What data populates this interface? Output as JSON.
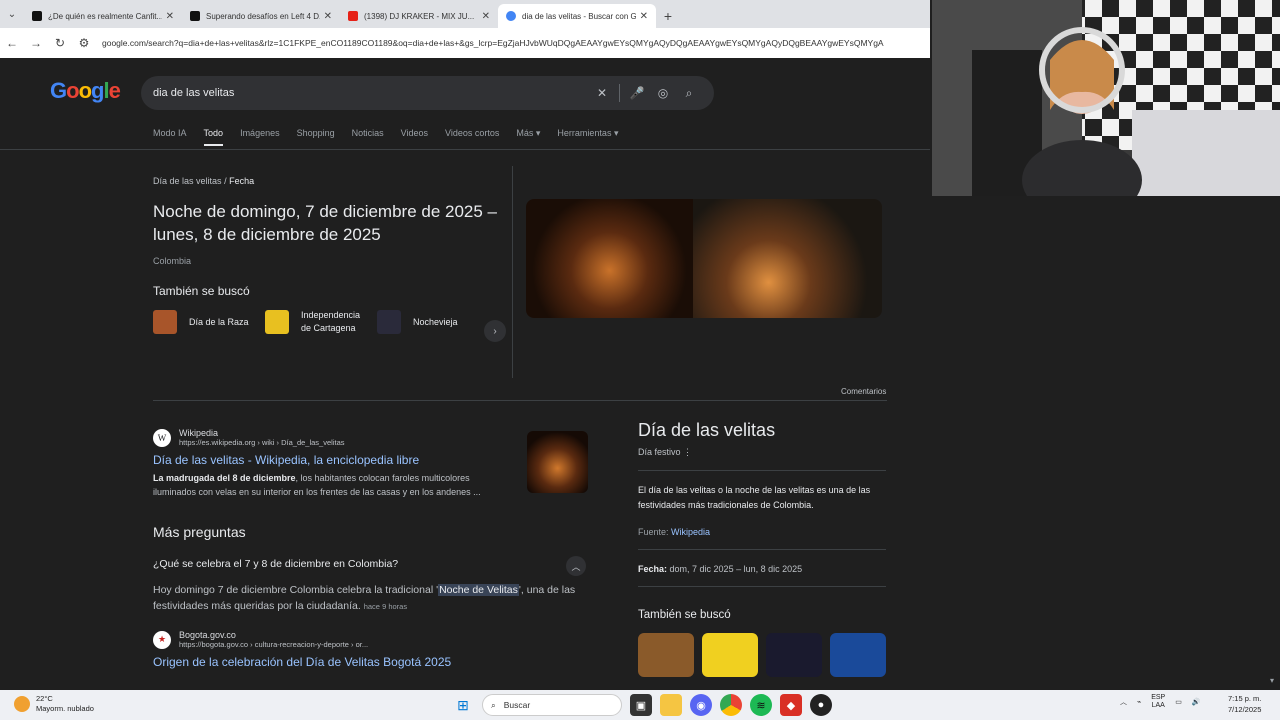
{
  "browser": {
    "tabs": [
      {
        "title": "¿De quién es realmente Canfit...",
        "favicon_color": "#111111",
        "active": false
      },
      {
        "title": "Superando desafíos en Left 4 D...",
        "favicon_color": "#111111",
        "active": false
      },
      {
        "title": "(1398) DJ KRAKER - MIX JU...",
        "favicon_color": "#e62117",
        "active": false
      },
      {
        "title": "dia de las velitas - Buscar con G...",
        "favicon_color": "#4285f4",
        "active": true
      }
    ],
    "new_tab_label": "+",
    "url": "google.com/search?q=dia+de+las+velitas&rlz=1C1FKPE_enCO1189CO1189&oq=dia+de+las+&gs_lcrp=EgZjaHJvbWUqDQgAEAAYgwEYsQMYgAQyDQgAEAAYgwEYsQMYgAQyDQgBEAAYgwEYsQMYgA"
  },
  "google": {
    "logo": "Google",
    "query": "dia de las velitas",
    "tabs": [
      "Modo IA",
      "Todo",
      "Imágenes",
      "Shopping",
      "Noticias",
      "Videos",
      "Videos cortos",
      "Más ▾",
      "Herramientas ▾"
    ],
    "active_tab": "Todo"
  },
  "featured": {
    "breadcrumb_root": "Día de las velitas",
    "breadcrumb_sep": "/",
    "breadcrumb_leaf": "Fecha",
    "date_text": "Noche de domingo, 7 de diciembre de 2025 – lunes, 8 de diciembre de 2025",
    "country": "Colombia",
    "also_heading": "También se buscó",
    "also_items": [
      {
        "label": "Día de la Raza",
        "color": "#a8552a"
      },
      {
        "label": "Independencia de Cartagena",
        "color": "#e8c020"
      },
      {
        "label": "Nochevieja",
        "color": "#2a2a3a"
      }
    ]
  },
  "feedback_label": "Comentarios",
  "result_wiki": {
    "site": "Wikipedia",
    "favicon_letter": "W",
    "cite": "https://es.wikipedia.org › wiki › Día_de_las_velitas",
    "title": "Día de las velitas - Wikipedia, la enciclopedia libre",
    "snippet_bold": "La madrugada del 8 de diciembre",
    "snippet_rest": ", los habitantes colocan faroles multicolores iluminados con velas en su interior en los frentes de las casas y en los andenes ..."
  },
  "paa": {
    "heading": "Más preguntas",
    "question": "¿Qué se celebra el 7 y 8 de diciembre en Colombia?",
    "answer_pre": "Hoy domingo 7 de diciembre Colombia celebra la tradicional '",
    "answer_mark": "Noche de Velitas",
    "answer_post": "', una de las festividades más queridas por la ciudadanía.",
    "answer_time": "hace 9 horas"
  },
  "result_bogota": {
    "site": "Bogota.gov.co",
    "favicon_letter": "★",
    "cite": "https://bogota.gov.co › cultura-recreacion-y-deporte › or...",
    "title": "Origen de la celebración del Día de Velitas Bogotá 2025"
  },
  "knowledge_panel": {
    "title": "Día de las velitas",
    "subtitle": "Día festivo",
    "description": "El día de las velitas o la noche de las velitas es una de las festividades más tradicionales de Colombia.",
    "source_label": "Fuente:",
    "source_link": "Wikipedia",
    "date_label": "Fecha:",
    "date_value": "dom, 7 dic 2025 – lun, 8 dic 2025",
    "also_heading": "También se buscó",
    "also_thumb_colors": [
      "#8a5a2a",
      "#f0d020",
      "#1a1a2e",
      "#1a4a9a"
    ]
  },
  "taskbar": {
    "temperature": "22°C",
    "weather": "Mayorm. nublado",
    "search_label": "Buscar",
    "lang": "ESP",
    "lang2": "LAA",
    "time": "7:15 p. m.",
    "date": "7/12/2025"
  }
}
